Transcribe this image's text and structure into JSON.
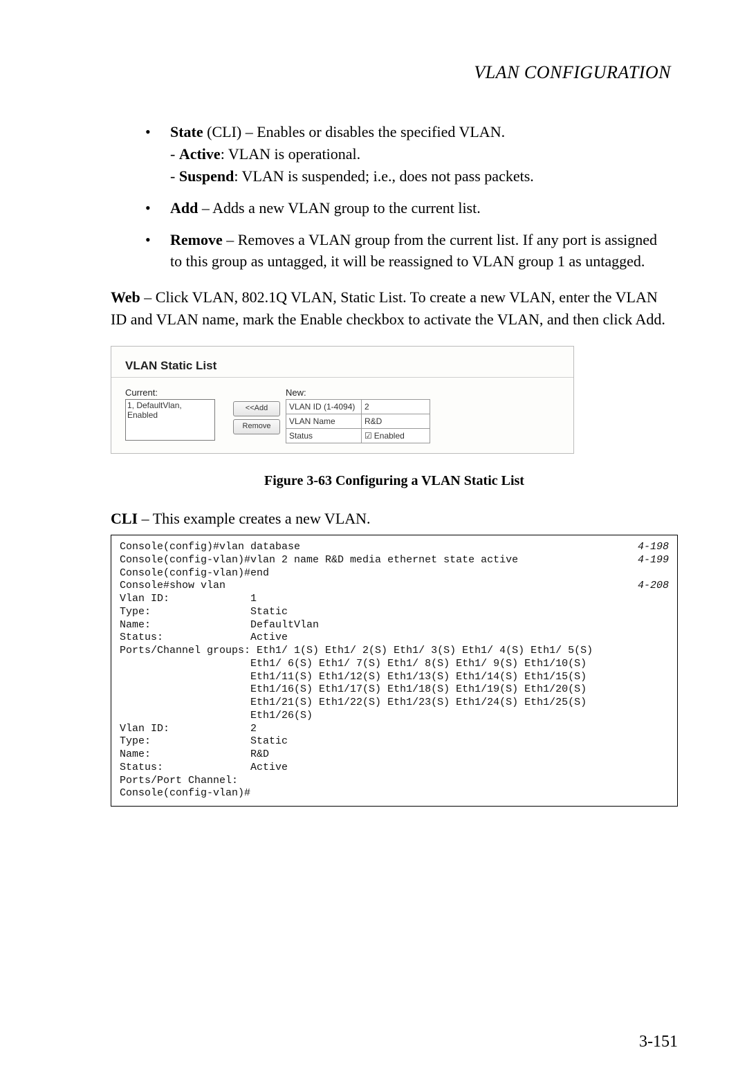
{
  "header": "VLAN CONFIGURATION",
  "bullets": {
    "state": {
      "lead": "State",
      "tail": " (CLI) – Enables or disables the specified VLAN.",
      "sub1_bold": "Active",
      "sub1_rest": ": VLAN is operational.",
      "sub2_bold": "Suspend",
      "sub2_rest": ": VLAN is suspended; i.e., does not pass packets."
    },
    "add": {
      "lead": "Add",
      "tail": " – Adds a new VLAN group to the current list."
    },
    "remove": {
      "lead": "Remove",
      "tail": " – Removes a VLAN group from the current list. If any port is assigned to this group as untagged, it will be reassigned to VLAN group 1 as untagged."
    }
  },
  "web_para": {
    "lead": "Web",
    "rest": " – Click VLAN, 802.1Q VLAN, Static List. To create a new VLAN, enter the VLAN ID and VLAN name, mark the Enable checkbox to activate the VLAN, and then click Add."
  },
  "figurebox": {
    "title": "VLAN Static List",
    "current_label": "Current:",
    "current_item": "1, DefaultVlan, Enabled",
    "add_btn": "<<Add",
    "remove_btn": "Remove",
    "new_label": "New:",
    "rows": {
      "r1_lbl": "VLAN ID (1-4094)",
      "r1_val": "2",
      "r2_lbl": "VLAN Name",
      "r2_val": "R&D",
      "r3_lbl": "Status",
      "r3_val": "Enabled"
    }
  },
  "fig_caption": "Figure 3-63  Configuring a VLAN Static List",
  "cli_para": {
    "lead": "CLI",
    "rest": " – This example creates a new VLAN."
  },
  "cli": {
    "l1": "Console(config)#vlan database",
    "r1": "4-198",
    "l2": "Console(config-vlan)#vlan 2 name R&D media ethernet state active",
    "r2": "4-199",
    "l3": "Console(config-vlan)#end",
    "l4": "Console#show vlan",
    "r4": "4-208",
    "l5": "Vlan ID:             1",
    "l6": "Type:                Static",
    "l7": "Name:                DefaultVlan",
    "l8": "Status:              Active",
    "l9": "Ports/Channel groups: Eth1/ 1(S) Eth1/ 2(S) Eth1/ 3(S) Eth1/ 4(S) Eth1/ 5(S)",
    "l10": "                     Eth1/ 6(S) Eth1/ 7(S) Eth1/ 8(S) Eth1/ 9(S) Eth1/10(S)",
    "l11": "                     Eth1/11(S) Eth1/12(S) Eth1/13(S) Eth1/14(S) Eth1/15(S)",
    "l12": "                     Eth1/16(S) Eth1/17(S) Eth1/18(S) Eth1/19(S) Eth1/20(S)",
    "l13": "                     Eth1/21(S) Eth1/22(S) Eth1/23(S) Eth1/24(S) Eth1/25(S)",
    "l14": "                     Eth1/26(S)",
    "l15": "",
    "l16": "",
    "l17": "Vlan ID:             2",
    "l18": "Type:                Static",
    "l19": "Name:                R&D",
    "l20": "Status:              Active",
    "l21": "Ports/Port Channel:",
    "l22": "",
    "l23": "Console(config-vlan)#"
  },
  "page_number": "3-151"
}
